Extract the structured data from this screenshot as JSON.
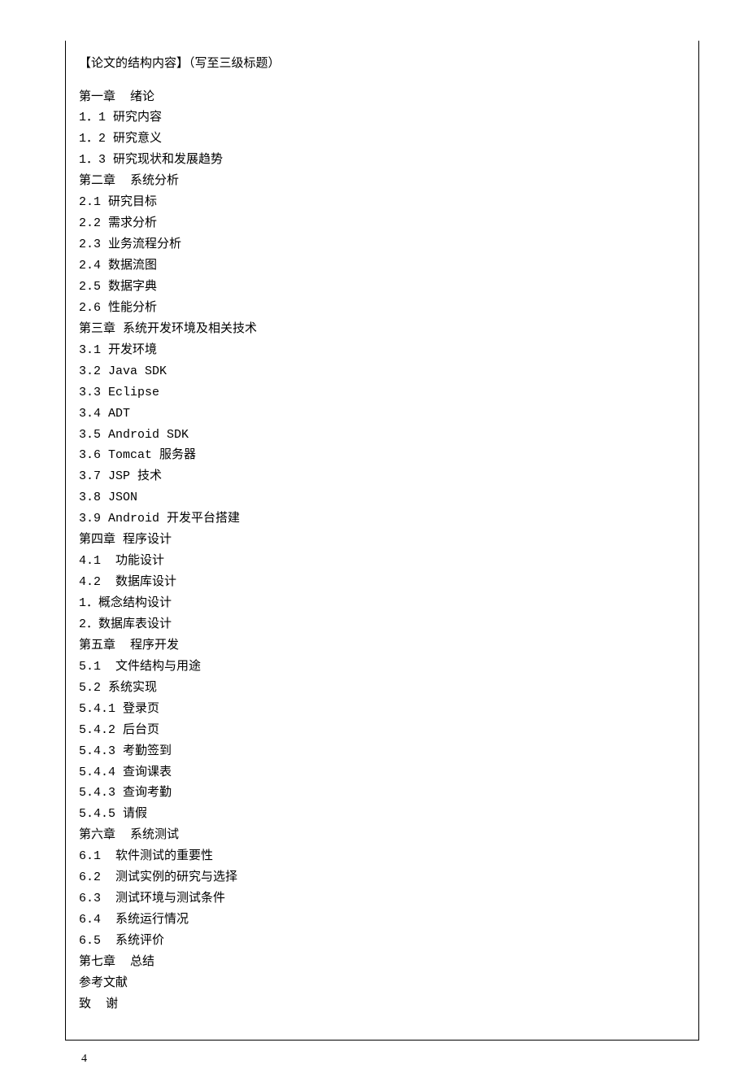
{
  "heading": "【论文的结构内容】（写至三级标题）",
  "lines": [
    "第一章  绪论",
    "1．1 研究内容",
    "1．2 研究意义",
    "1．3 研究现状和发展趋势",
    "第二章  系统分析",
    "2.1 研究目标",
    "2.2 需求分析",
    "2.3 业务流程分析",
    "2.4 数据流图",
    "2.5 数据字典",
    "2.6 性能分析",
    "第三章 系统开发环境及相关技术",
    "3.1 开发环境",
    "3.2 Java SDK",
    "3.3 Eclipse",
    "3.4 ADT",
    "3.5 Android SDK",
    "3.6 Tomcat 服务器",
    "3.7 JSP 技术",
    "3.8 JSON",
    "3.9 Android 开发平台搭建",
    "第四章 程序设计",
    "4.1  功能设计",
    "4.2  数据库设计",
    "1．概念结构设计",
    "2．数据库表设计",
    "第五章  程序开发",
    "5.1  文件结构与用途",
    "5.2 系统实现",
    "5.4.1 登录页",
    "5.4.2 后台页",
    "5.4.3 考勤签到",
    "5.4.4 查询课表",
    "5.4.3 查询考勤",
    "5.4.5 请假",
    "第六章  系统测试",
    "6.1  软件测试的重要性",
    "6.2  测试实例的研究与选择",
    "6.3  测试环境与测试条件",
    "6.4  系统运行情况",
    "6.5  系统评价",
    "第七章  总结",
    "参考文献",
    "致  谢"
  ],
  "pageNumber": "4"
}
